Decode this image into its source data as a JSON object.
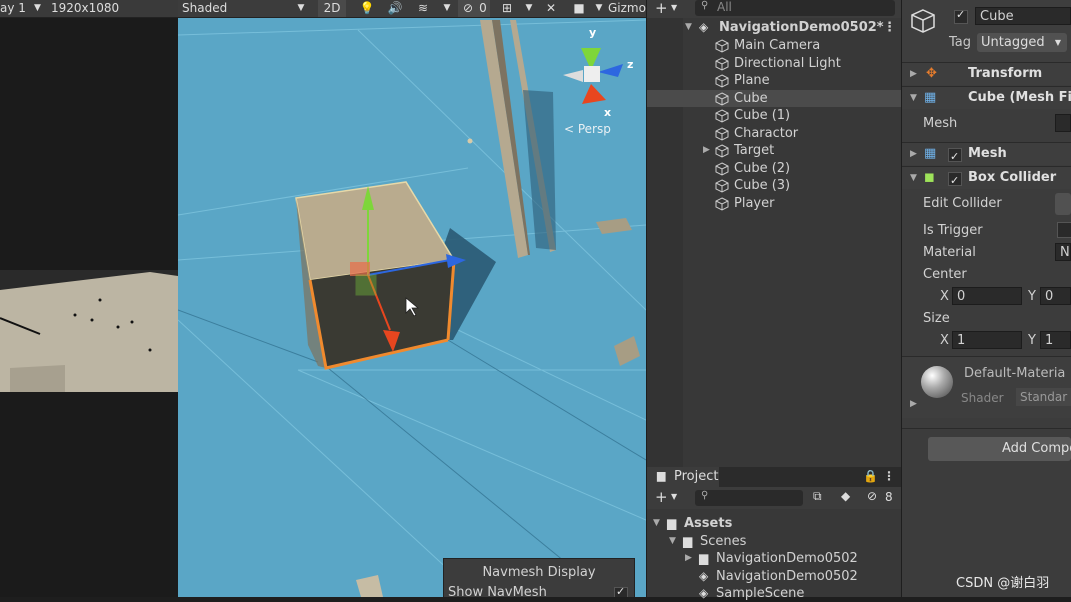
{
  "game": {
    "display_label": "ay 1",
    "resolution": "1920x1080"
  },
  "scene": {
    "shading_mode": "Shaded",
    "mode_2d": "2D",
    "hidden_count": "0",
    "gizmos_label": "Gizmo",
    "persp_label": "< Persp",
    "gizmo_axes": {
      "x": "x",
      "y": "y",
      "z": "z"
    },
    "navmesh_display": {
      "title": "Navmesh Display",
      "show_navmesh_label": "Show NavMesh"
    }
  },
  "hierarchy": {
    "search_placeholder": "All",
    "scene_name": "NavigationDemo0502*",
    "items": [
      {
        "label": "Main Camera",
        "selected": false,
        "expandable": false
      },
      {
        "label": "Directional Light",
        "selected": false,
        "expandable": false
      },
      {
        "label": "Plane",
        "selected": false,
        "expandable": false
      },
      {
        "label": "Cube",
        "selected": true,
        "expandable": false
      },
      {
        "label": "Cube (1)",
        "selected": false,
        "expandable": false
      },
      {
        "label": "Charactor",
        "selected": false,
        "expandable": false
      },
      {
        "label": "Target",
        "selected": false,
        "expandable": true
      },
      {
        "label": "Cube (2)",
        "selected": false,
        "expandable": false
      },
      {
        "label": "Cube (3)",
        "selected": false,
        "expandable": false
      },
      {
        "label": "Player",
        "selected": false,
        "expandable": false
      }
    ]
  },
  "project": {
    "tab_label": "Project",
    "hidden_count": "8",
    "tree": [
      {
        "label": "Assets",
        "type": "folder"
      },
      {
        "label": "Scenes",
        "type": "folder"
      },
      {
        "label": "NavigationDemo0502",
        "type": "folder"
      },
      {
        "label": "NavigationDemo0502",
        "type": "scene"
      },
      {
        "label": "SampleScene",
        "type": "scene"
      }
    ]
  },
  "inspector": {
    "object_name": "Cube",
    "tag_label": "Tag",
    "tag_value": "Untagged",
    "components": {
      "transform": "Transform",
      "mesh_filter": "Cube (Mesh Filt",
      "mesh_label": "Mesh",
      "mesh_renderer": "Mesh Renderer",
      "box_collider": "Box Collider"
    },
    "box_collider": {
      "edit_collider": "Edit Collider",
      "is_trigger": "Is Trigger",
      "material": "Material",
      "material_value": "No",
      "center": "Center",
      "size": "Size",
      "x_label": "X",
      "y_label": "Y",
      "center_x": "0",
      "center_y": "0",
      "size_x": "1",
      "size_y": "1"
    },
    "material_preview": {
      "name": "Default-Materia",
      "shader_label": "Shader",
      "shader_value": "Standar"
    },
    "add_component": "Add Compo"
  },
  "watermark": "CSDN @谢白羽",
  "colors": {
    "ground": "#5aa6c6",
    "selection": "#4b4b4b",
    "panel": "#383838",
    "cube_top": "#b9ab8e",
    "cube_dark": "#3a3a33",
    "axis_x": "#e8461f",
    "axis_y": "#7ed63a",
    "axis_z": "#2d67e0"
  }
}
